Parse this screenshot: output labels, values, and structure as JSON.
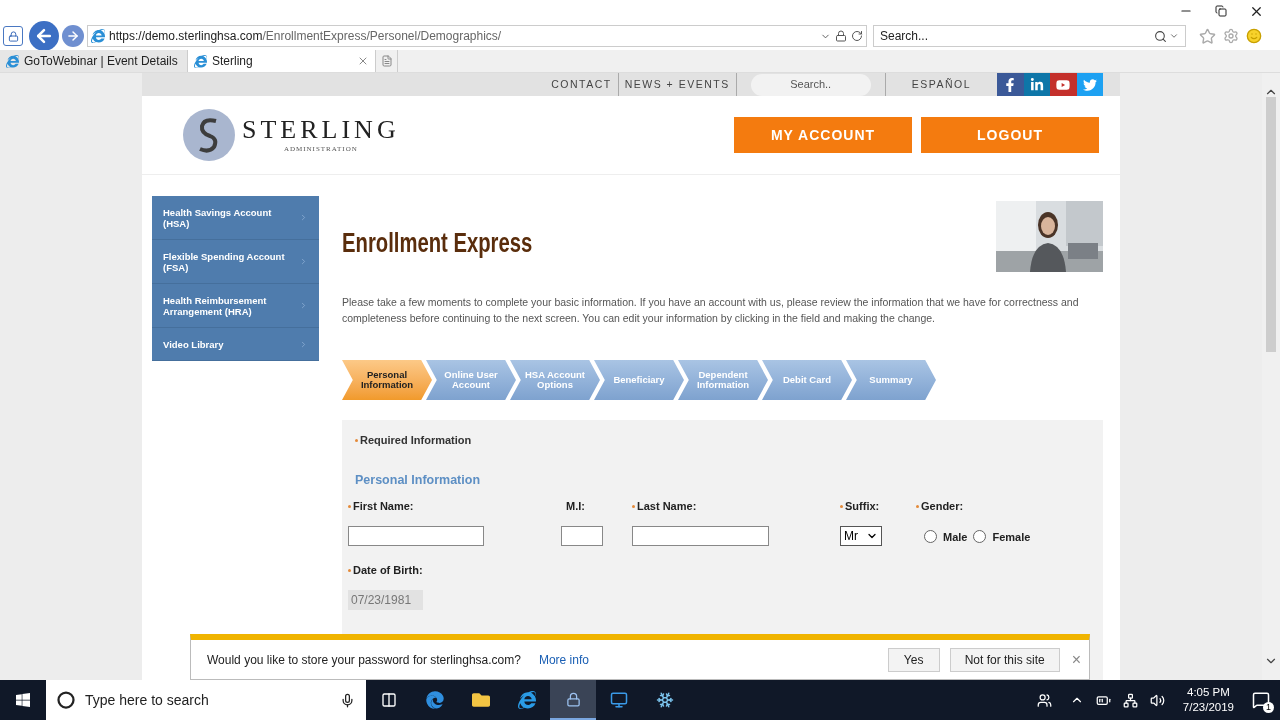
{
  "browser": {
    "url_host": "https://demo.sterlinghsa.com",
    "url_path": "/EnrollmentExpress/Personel/Demographics/",
    "search_placeholder": "Search...",
    "tabs": [
      {
        "label": "GoToWebinar | Event Details",
        "selected": false
      },
      {
        "label": "Sterling",
        "selected": true
      }
    ]
  },
  "site": {
    "top_nav": [
      "CONTACT",
      "NEWS + EVENTS"
    ],
    "search_placeholder": "Search..",
    "language": "ESPAÑOL",
    "logo": {
      "name": "STERLING",
      "tagline": "ADMINISTRATION"
    },
    "header_buttons": [
      "MY ACCOUNT",
      "LOGOUT"
    ]
  },
  "sidebar": {
    "items": [
      {
        "label": "Health Savings Account (HSA)"
      },
      {
        "label": "Flexible Spending Account (FSA)"
      },
      {
        "label": "Health Reimbursement Arrangement (HRA)"
      },
      {
        "label": "Video Library"
      }
    ]
  },
  "title": "Enrollment Express",
  "intro": "Please take a few moments to complete your basic information. If you have an account with us, please review the information that we have for correctness and completeness before continuing to the next screen. You can edit your information by clicking in the field and making the change.",
  "steps": [
    {
      "label": "Personal Information",
      "selected": true
    },
    {
      "label": "Online User Account",
      "selected": false
    },
    {
      "label": "HSA Account Options",
      "selected": false
    },
    {
      "label": "Beneficiary",
      "selected": false
    },
    {
      "label": "Dependent Information",
      "selected": false
    },
    {
      "label": "Debit Card",
      "selected": false
    },
    {
      "label": "Summary",
      "selected": false
    }
  ],
  "form": {
    "required_note": "Required Information",
    "section": "Personal Information",
    "row_1": [
      {
        "kind": "text",
        "label": "First Name:",
        "required": true
      },
      {
        "kind": "text",
        "label": "M.I:",
        "required": false
      },
      {
        "kind": "text",
        "label": "Last Name:",
        "required": true
      },
      {
        "kind": "select",
        "label": "Suffix:",
        "required": true,
        "value": "Mr"
      },
      {
        "kind": "radio",
        "label": "Gender:",
        "required": true,
        "options": [
          {
            "label": "Male",
            "checked": false
          },
          {
            "label": "Female",
            "checked": false
          }
        ]
      }
    ],
    "row_2": [
      {
        "kind": "text",
        "label": "Date of Birth:",
        "required": true,
        "value": "07/23/1981",
        "disabled": true
      }
    ]
  },
  "password_bar": {
    "message": "Would you like to store your password for sterlinghsa.com?",
    "link": "More info",
    "buttons": [
      "Yes",
      "Not for this site"
    ],
    "close": "×"
  },
  "taskbar": {
    "search_placeholder": "Type here to search",
    "time": "4:05 PM",
    "date": "7/23/2019",
    "notifications": "1"
  }
}
